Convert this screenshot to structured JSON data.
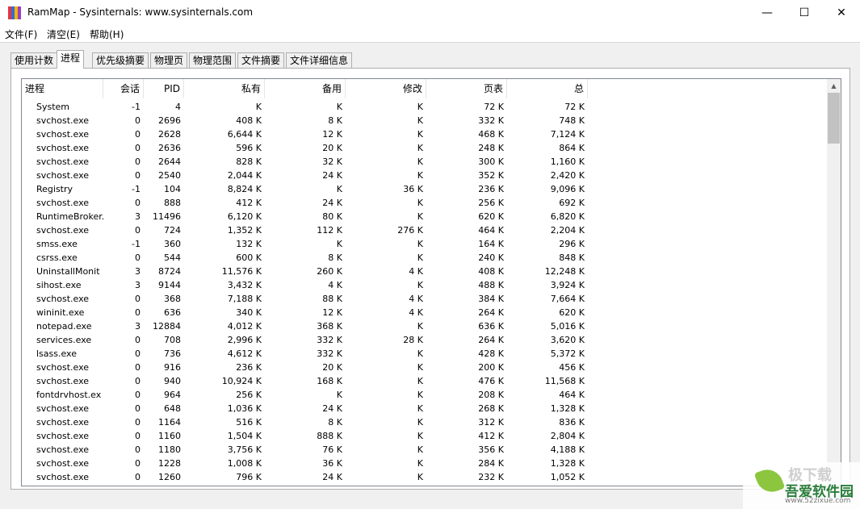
{
  "window": {
    "title": "RamMap - Sysinternals: www.sysinternals.com",
    "icon_colors": [
      "#e8343f",
      "#2f6fdc",
      "#f6b400",
      "#9b3fc1"
    ],
    "minimize_glyph": "—",
    "maximize_glyph": "☐",
    "close_glyph": "✕"
  },
  "menu": [
    "文件(F)",
    "清空(E)",
    "帮助(H)"
  ],
  "tabs": [
    "使用计数",
    "进程",
    "优先级摘要",
    "物理页",
    "物理范围",
    "文件摘要",
    "文件详细信息"
  ],
  "active_tab": "进程",
  "table": {
    "columns": [
      "进程",
      "会话",
      "PID",
      "私有",
      "备用",
      "修改",
      "页表",
      "总"
    ],
    "rows": [
      [
        "System",
        "-1",
        "4",
        "K",
        "K",
        "K",
        "72 K",
        "72 K"
      ],
      [
        "svchost.exe",
        "0",
        "2696",
        "408 K",
        "8 K",
        "K",
        "332 K",
        "748 K"
      ],
      [
        "svchost.exe",
        "0",
        "2628",
        "6,644 K",
        "12 K",
        "K",
        "468 K",
        "7,124 K"
      ],
      [
        "svchost.exe",
        "0",
        "2636",
        "596 K",
        "20 K",
        "K",
        "248 K",
        "864 K"
      ],
      [
        "svchost.exe",
        "0",
        "2644",
        "828 K",
        "32 K",
        "K",
        "300 K",
        "1,160 K"
      ],
      [
        "svchost.exe",
        "0",
        "2540",
        "2,044 K",
        "24 K",
        "K",
        "352 K",
        "2,420 K"
      ],
      [
        "Registry",
        "-1",
        "104",
        "8,824 K",
        "K",
        "36 K",
        "236 K",
        "9,096 K"
      ],
      [
        "svchost.exe",
        "0",
        "888",
        "412 K",
        "24 K",
        "K",
        "256 K",
        "692 K"
      ],
      [
        "RuntimeBroker.",
        "3",
        "11496",
        "6,120 K",
        "80 K",
        "K",
        "620 K",
        "6,820 K"
      ],
      [
        "svchost.exe",
        "0",
        "724",
        "1,352 K",
        "112 K",
        "276 K",
        "464 K",
        "2,204 K"
      ],
      [
        "smss.exe",
        "-1",
        "360",
        "132 K",
        "K",
        "K",
        "164 K",
        "296 K"
      ],
      [
        "csrss.exe",
        "0",
        "544",
        "600 K",
        "8 K",
        "K",
        "240 K",
        "848 K"
      ],
      [
        "UninstallMonit",
        "3",
        "8724",
        "11,576 K",
        "260 K",
        "4 K",
        "408 K",
        "12,248 K"
      ],
      [
        "sihost.exe",
        "3",
        "9144",
        "3,432 K",
        "4 K",
        "K",
        "488 K",
        "3,924 K"
      ],
      [
        "svchost.exe",
        "0",
        "368",
        "7,188 K",
        "88 K",
        "4 K",
        "384 K",
        "7,664 K"
      ],
      [
        "wininit.exe",
        "0",
        "636",
        "340 K",
        "12 K",
        "4 K",
        "264 K",
        "620 K"
      ],
      [
        "notepad.exe",
        "3",
        "12884",
        "4,012 K",
        "368 K",
        "K",
        "636 K",
        "5,016 K"
      ],
      [
        "services.exe",
        "0",
        "708",
        "2,996 K",
        "332 K",
        "28 K",
        "264 K",
        "3,620 K"
      ],
      [
        "lsass.exe",
        "0",
        "736",
        "4,612 K",
        "332 K",
        "K",
        "428 K",
        "5,372 K"
      ],
      [
        "svchost.exe",
        "0",
        "916",
        "236 K",
        "20 K",
        "K",
        "200 K",
        "456 K"
      ],
      [
        "svchost.exe",
        "0",
        "940",
        "10,924 K",
        "168 K",
        "K",
        "476 K",
        "11,568 K"
      ],
      [
        "fontdrvhost.ex",
        "0",
        "964",
        "256 K",
        "K",
        "K",
        "208 K",
        "464 K"
      ],
      [
        "svchost.exe",
        "0",
        "648",
        "1,036 K",
        "24 K",
        "K",
        "268 K",
        "1,328 K"
      ],
      [
        "svchost.exe",
        "0",
        "1164",
        "516 K",
        "8 K",
        "K",
        "312 K",
        "836 K"
      ],
      [
        "svchost.exe",
        "0",
        "1160",
        "1,504 K",
        "888 K",
        "K",
        "412 K",
        "2,804 K"
      ],
      [
        "svchost.exe",
        "0",
        "1180",
        "3,756 K",
        "76 K",
        "K",
        "356 K",
        "4,188 K"
      ],
      [
        "svchost.exe",
        "0",
        "1228",
        "1,008 K",
        "36 K",
        "K",
        "284 K",
        "1,328 K"
      ],
      [
        "svchost.exe",
        "0",
        "1260",
        "796 K",
        "24 K",
        "K",
        "232 K",
        "1,052 K"
      ]
    ]
  },
  "watermark": {
    "top_text": "极下载",
    "name": "吾爱软件园",
    "url": "www.52zixue.com"
  }
}
